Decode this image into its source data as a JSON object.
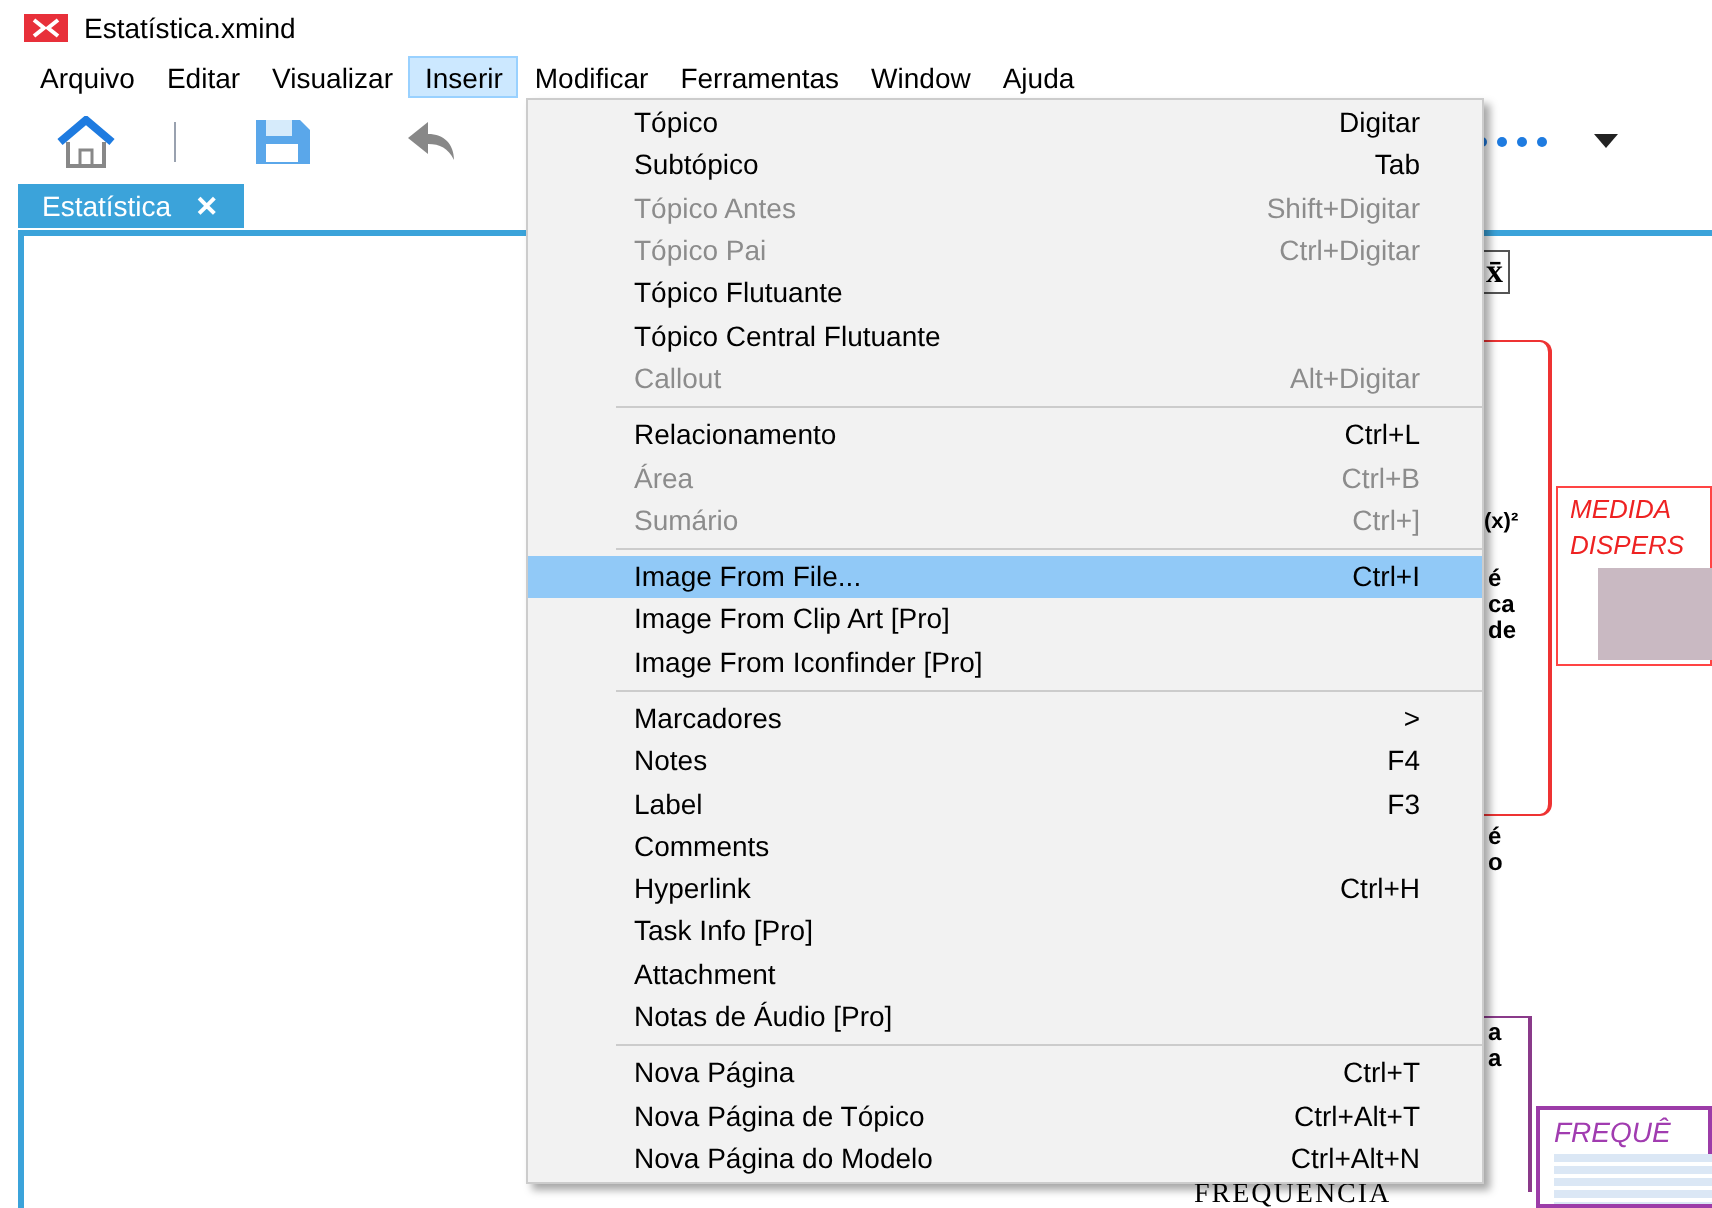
{
  "window": {
    "title": "Estatística.xmind"
  },
  "menu_bar": [
    {
      "label": "Arquivo",
      "selected": false
    },
    {
      "label": "Editar",
      "selected": false
    },
    {
      "label": "Visualizar",
      "selected": false
    },
    {
      "label": "Inserir",
      "selected": true
    },
    {
      "label": "Modificar",
      "selected": false
    },
    {
      "label": "Ferramentas",
      "selected": false
    },
    {
      "label": "Window",
      "selected": false
    },
    {
      "label": "Ajuda",
      "selected": false
    }
  ],
  "tabs": [
    {
      "label": "Estatística",
      "close": "✕",
      "selected": true
    }
  ],
  "menu": [
    {
      "kind": "item",
      "label": "Tópico",
      "shortcut": "Digitar",
      "disabled": false,
      "selected": false
    },
    {
      "kind": "item",
      "label": "Subtópico",
      "shortcut": "Tab",
      "disabled": false,
      "selected": false
    },
    {
      "kind": "item",
      "label": "Tópico Antes",
      "shortcut": "Shift+Digitar",
      "disabled": true,
      "selected": false
    },
    {
      "kind": "item",
      "label": "Tópico Pai",
      "shortcut": "Ctrl+Digitar",
      "disabled": true,
      "selected": false
    },
    {
      "kind": "item",
      "label": "Tópico Flutuante",
      "disabled": false,
      "selected": false
    },
    {
      "kind": "item",
      "label": "Tópico Central Flutuante",
      "disabled": false,
      "selected": false
    },
    {
      "kind": "item",
      "label": "Callout",
      "shortcut": "Alt+Digitar",
      "disabled": true,
      "selected": false
    },
    {
      "kind": "separator"
    },
    {
      "kind": "item",
      "label": "Relacionamento",
      "shortcut": "Ctrl+L",
      "disabled": false,
      "selected": false
    },
    {
      "kind": "item",
      "label": "Área",
      "shortcut": "Ctrl+B",
      "disabled": true,
      "selected": false
    },
    {
      "kind": "item",
      "label": "Sumário",
      "shortcut": "Ctrl+]",
      "disabled": true,
      "selected": false
    },
    {
      "kind": "separator"
    },
    {
      "kind": "item",
      "label": "Image From File...",
      "shortcut": "Ctrl+I",
      "disabled": false,
      "selected": true
    },
    {
      "kind": "item",
      "label": "Image From Clip Art [Pro]",
      "disabled": false,
      "selected": false
    },
    {
      "kind": "item",
      "label": "Image From Iconfinder [Pro]",
      "disabled": false,
      "selected": false
    },
    {
      "kind": "separator"
    },
    {
      "kind": "item",
      "label": "Marcadores",
      "shortcut": ">",
      "disabled": false,
      "selected": false
    },
    {
      "kind": "item",
      "label": "Notes",
      "shortcut": "F4",
      "disabled": false,
      "selected": false
    },
    {
      "kind": "item",
      "label": "Label",
      "shortcut": "F3",
      "disabled": false,
      "selected": false
    },
    {
      "kind": "item",
      "label": "Comments",
      "disabled": false,
      "selected": false
    },
    {
      "kind": "item",
      "label": "Hyperlink",
      "shortcut": "Ctrl+H",
      "disabled": false,
      "selected": false
    },
    {
      "kind": "item",
      "label": "Task Info [Pro]",
      "disabled": false,
      "selected": false
    },
    {
      "kind": "item",
      "label": "Attachment",
      "disabled": false,
      "selected": false
    },
    {
      "kind": "item",
      "label": "Notas de Áudio [Pro]",
      "disabled": false,
      "selected": false
    },
    {
      "kind": "separator"
    },
    {
      "kind": "item",
      "label": "Nova Página",
      "shortcut": "Ctrl+T",
      "disabled": false,
      "selected": false
    },
    {
      "kind": "item",
      "label": "Nova Página de Tópico",
      "shortcut": "Ctrl+Alt+T",
      "disabled": false,
      "selected": false
    },
    {
      "kind": "item",
      "label": "Nova Página do Modelo",
      "shortcut": "Ctrl+Alt+N",
      "disabled": false,
      "selected": false
    }
  ],
  "canvas": {
    "symbol": "x̄",
    "formula": "(x)²",
    "fragment_1": [
      "é",
      "ca",
      "de"
    ],
    "fragment_2": [
      "é",
      "o"
    ],
    "fragment_3": [
      "a",
      "a"
    ],
    "dispersion_topic": [
      "MEDIDA",
      "DISPERS"
    ],
    "frequency_topic": "FREQUÊ",
    "bottom_text": "FREQUENCIA"
  }
}
